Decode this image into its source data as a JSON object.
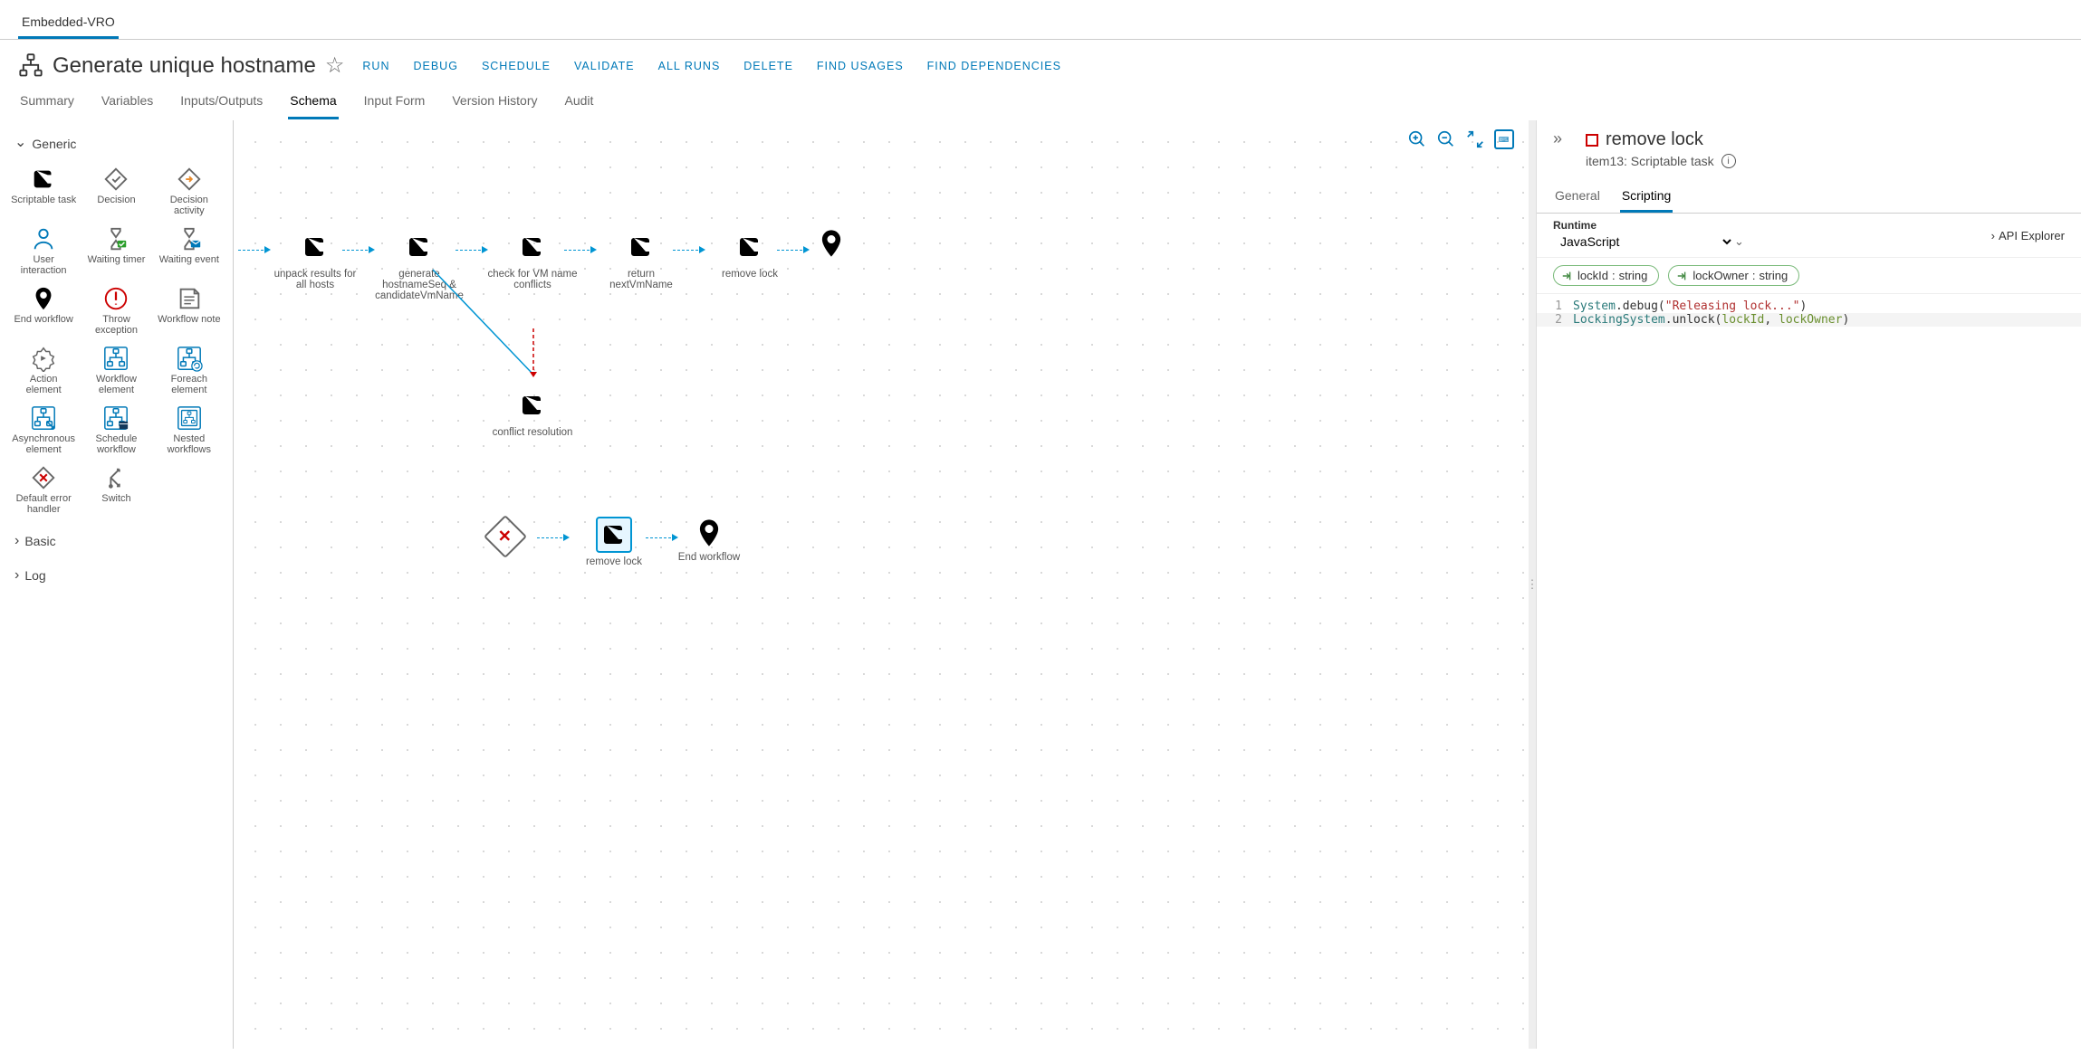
{
  "top_tab": "Embedded-VRO",
  "page_title": "Generate unique hostname",
  "actions": [
    "RUN",
    "DEBUG",
    "SCHEDULE",
    "VALIDATE",
    "ALL RUNS",
    "DELETE",
    "FIND USAGES",
    "FIND DEPENDENCIES"
  ],
  "subtabs": [
    "Summary",
    "Variables",
    "Inputs/Outputs",
    "Schema",
    "Input Form",
    "Version History",
    "Audit"
  ],
  "subtab_active": "Schema",
  "palette": {
    "groups": [
      {
        "name": "Generic",
        "open": true,
        "items": [
          "Scriptable task",
          "Decision",
          "Decision activity",
          "User interaction",
          "Waiting timer",
          "Waiting event",
          "End workflow",
          "Throw exception",
          "Workflow note",
          "Action element",
          "Workflow element",
          "Foreach element",
          "Asynchronous element",
          "Schedule workflow",
          "Nested workflows",
          "Default error handler",
          "Switch"
        ]
      },
      {
        "name": "Basic",
        "open": false
      },
      {
        "name": "Log",
        "open": false
      }
    ]
  },
  "nodes": {
    "row1": [
      {
        "label": "unpack results for all hosts"
      },
      {
        "label": "generate hostnameSeq & candidateVmName"
      },
      {
        "label": "check for VM name conflicts"
      },
      {
        "label": "return nextVmName"
      },
      {
        "label": "remove lock"
      },
      {
        "label": "",
        "kind": "pin"
      }
    ],
    "conflict": {
      "label": "conflict resolution"
    },
    "row2": [
      {
        "label": "",
        "kind": "diamond"
      },
      {
        "label": "remove lock",
        "selected": true
      },
      {
        "label": "End workflow",
        "kind": "pin"
      }
    ]
  },
  "rightpane": {
    "title": "remove lock",
    "subtitle": "item13: Scriptable task",
    "tabs": [
      "General",
      "Scripting"
    ],
    "tab_active": "Scripting",
    "runtime_label": "Runtime",
    "runtime_value": "JavaScript",
    "api_explorer": "API Explorer",
    "pills": [
      {
        "name": "lockId",
        "type": "string"
      },
      {
        "name": "lockOwner",
        "type": "string"
      }
    ],
    "code": {
      "line1": {
        "n": "1",
        "a": "System",
        "b": ".debug(",
        "c": "\"Releasing lock...\"",
        "d": ")"
      },
      "line2": {
        "n": "2",
        "a": "LockingSystem",
        "b": ".unlock(",
        "c": "lockId",
        "d": ", ",
        "e": "lockOwner",
        "f": ")"
      }
    }
  }
}
